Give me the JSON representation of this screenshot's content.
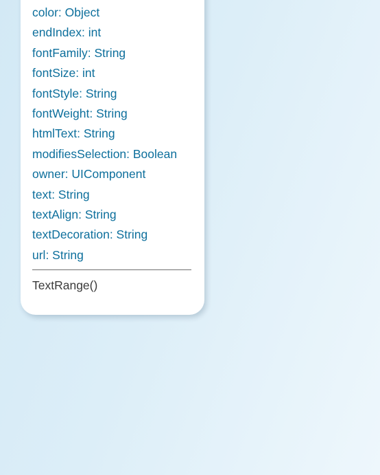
{
  "class_box": {
    "attributes": [
      "color: Object",
      "endIndex: int",
      "fontFamily: String",
      "fontSize: int",
      "fontStyle: String",
      "fontWeight: String",
      "htmlText: String",
      "modifiesSelection: Boolean",
      "owner: UIComponent",
      "text: String",
      "textAlign: String",
      "textDecoration: String",
      "url: String"
    ],
    "operations": [
      "TextRange()"
    ],
    "colors": {
      "attribute_text": "#0d6f9c",
      "operation_text": "#3a3a3a",
      "box_background": "#ffffff",
      "page_background": "#dceef8"
    }
  }
}
